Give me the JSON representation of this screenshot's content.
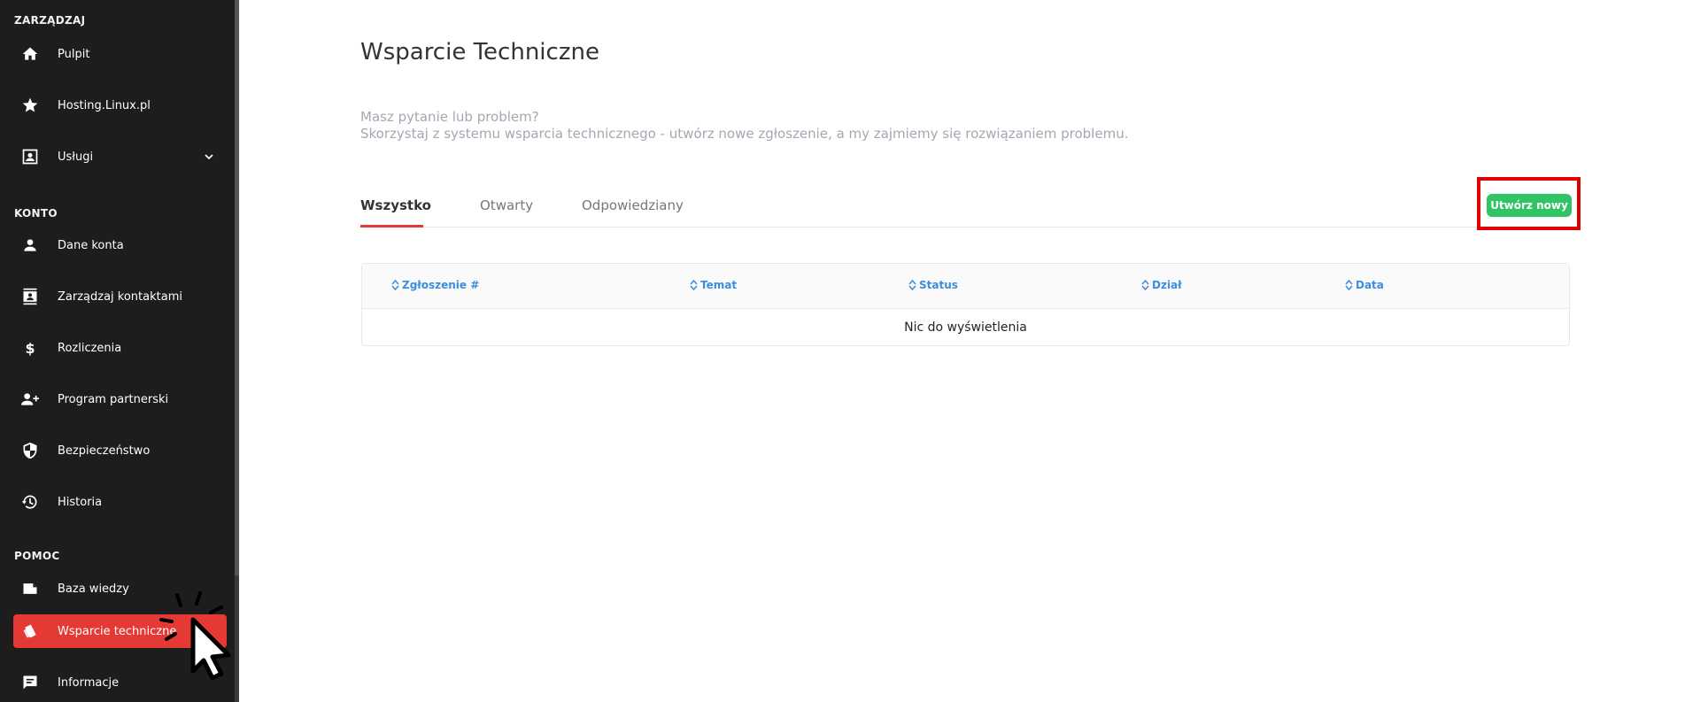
{
  "sidebar": {
    "sections": {
      "manage": "ZARZĄDZAJ",
      "account": "KONTO",
      "help": "POMOC"
    },
    "items": [
      {
        "label": "Pulpit",
        "icon": "home-icon"
      },
      {
        "label": "Hosting.Linux.pl",
        "icon": "star-icon"
      },
      {
        "label": "Usługi",
        "icon": "contact-box-icon"
      },
      {
        "label": "Dane konta",
        "icon": "person-icon"
      },
      {
        "label": "Zarządzaj kontaktami",
        "icon": "contacts-icon"
      },
      {
        "label": "Rozliczenia",
        "icon": "dollar-icon"
      },
      {
        "label": "Program partnerski",
        "icon": "add-person-icon"
      },
      {
        "label": "Bezpieczeństwo",
        "icon": "shield-icon"
      },
      {
        "label": "Historia",
        "icon": "history-icon"
      },
      {
        "label": "Baza wiedzy",
        "icon": "note-icon"
      },
      {
        "label": "Wsparcie techniczne",
        "icon": "ticket-icon"
      },
      {
        "label": "Informacje",
        "icon": "announcement-icon"
      }
    ],
    "active_color": "#e53935"
  },
  "main": {
    "title": "Wsparcie Techniczne",
    "intro_line1": "Masz pytanie lub problem?",
    "intro_line2": "Skorzystaj z systemu wsparcia technicznego - utwórz nowe zgłoszenie, a my zajmiemy się rozwiązaniem problemu.",
    "tabs": [
      {
        "label": "Wszystko"
      },
      {
        "label": "Otwarty"
      },
      {
        "label": "Odpowiedziany"
      }
    ],
    "create_button": "Utwórz nowy",
    "create_button_color": "#2fc464",
    "table": {
      "columns": [
        "Zgłoszenie #",
        "Temat",
        "Status",
        "Dział",
        "Data"
      ],
      "empty_text": "Nic do wyświetlenia"
    }
  }
}
